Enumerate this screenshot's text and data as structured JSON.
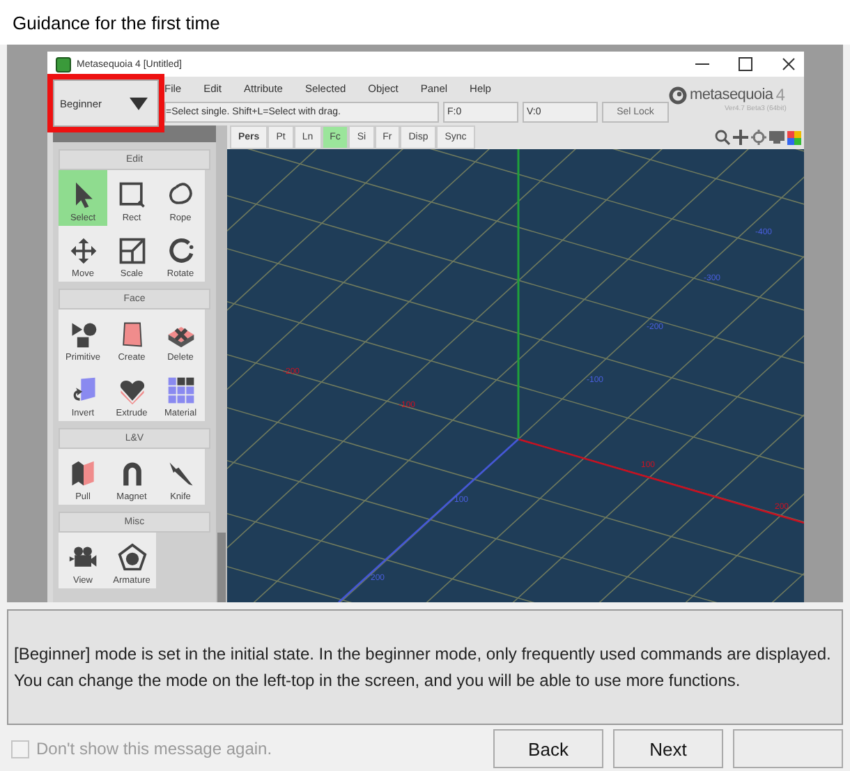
{
  "window": {
    "title": "Guidance for the first time"
  },
  "app": {
    "title": "Metasequoia 4 [Untitled]",
    "mode_dropdown": {
      "value": "Beginner",
      "highlighted": true
    },
    "menu": [
      "File",
      "Edit",
      "Attribute",
      "Selected",
      "Object",
      "Panel",
      "Help"
    ],
    "status": {
      "hint": "=Select single.  Shift+L=Select with drag.",
      "faces": "F:0",
      "vertices": "V:0",
      "lock_button": "Sel Lock"
    },
    "logo": {
      "name": "metasequoia",
      "number": "4",
      "version": "Ver4.7 Beta3 (64bit)"
    },
    "view_tabs": [
      {
        "label": "Pers",
        "selected": false
      },
      {
        "label": "Pt",
        "selected": false
      },
      {
        "label": "Ln",
        "selected": false
      },
      {
        "label": "Fc",
        "selected": true
      },
      {
        "label": "Si",
        "selected": false
      },
      {
        "label": "Fr",
        "selected": false
      },
      {
        "label": "Disp",
        "selected": false
      },
      {
        "label": "Sync",
        "selected": false
      }
    ],
    "tool_groups": [
      {
        "title": "Edit",
        "tools": [
          {
            "label": "Select",
            "selected": true
          },
          {
            "label": "Rect",
            "selected": false
          },
          {
            "label": "Rope",
            "selected": false
          },
          {
            "label": "Move",
            "selected": false
          },
          {
            "label": "Scale",
            "selected": false
          },
          {
            "label": "Rotate",
            "selected": false
          }
        ]
      },
      {
        "title": "Face",
        "tools": [
          {
            "label": "Primitive",
            "selected": false
          },
          {
            "label": "Create",
            "selected": false
          },
          {
            "label": "Delete",
            "selected": false
          },
          {
            "label": "Invert",
            "selected": false
          },
          {
            "label": "Extrude",
            "selected": false
          },
          {
            "label": "Material",
            "selected": false
          }
        ]
      },
      {
        "title": "L&V",
        "tools": [
          {
            "label": "Pull",
            "selected": false
          },
          {
            "label": "Magnet",
            "selected": false
          },
          {
            "label": "Knife",
            "selected": false
          }
        ]
      },
      {
        "title": "Misc",
        "tools": [
          {
            "label": "View",
            "selected": false
          },
          {
            "label": "Armature",
            "selected": false
          }
        ]
      }
    ],
    "axis_labels": [
      {
        "text": "-400",
        "color": "#4a5fe0"
      },
      {
        "text": "-300",
        "color": "#4a5fe0"
      },
      {
        "text": "-200",
        "color": "#4a5fe0"
      },
      {
        "text": "-100",
        "color": "#4a5fe0"
      },
      {
        "text": "-200",
        "color": "#d01020"
      },
      {
        "text": "-100",
        "color": "#d01020"
      },
      {
        "text": "100",
        "color": "#d01020"
      },
      {
        "text": "100",
        "color": "#4a5fe0"
      },
      {
        "text": "200",
        "color": "#d01020"
      },
      {
        "text": "200",
        "color": "#4a5fe0"
      }
    ]
  },
  "message": "[Beginner] mode is set in the initial state. In the beginner mode, only frequently used commands are displayed. You can change the mode on the left-top in the screen, and you will be able to use more functions.",
  "dont_show": {
    "label": "Don't show this message again.",
    "checked": false,
    "disabled": true
  },
  "buttons": [
    "Back",
    "Next"
  ]
}
